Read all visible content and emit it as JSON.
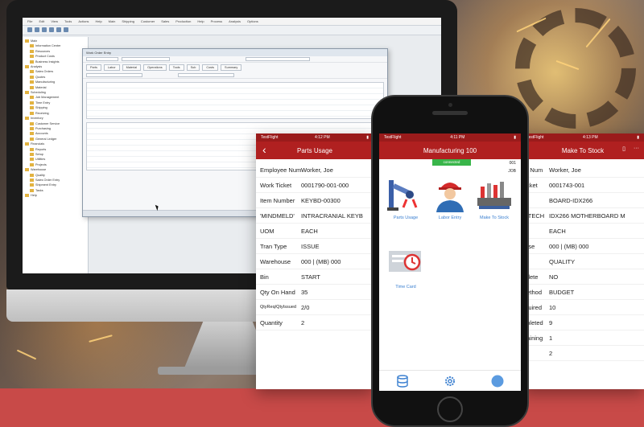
{
  "desktop": {
    "menu": [
      "File",
      "Edit",
      "View",
      "Tools",
      "Actions",
      "Help",
      "Main",
      "Shipping",
      "Customer",
      "Sales",
      "Production",
      "Help",
      "Process",
      "Analysis",
      "Options"
    ],
    "tree_items": [
      "Main",
      "Information Center",
      "Resources",
      "Product Costs",
      "Business Insights",
      "Analysis",
      "Sales Orders",
      "Quotes",
      "Manufacturing",
      "Material",
      "Scheduling",
      "Job Management",
      "Time Entry",
      "Shipping",
      "Receiving",
      "Inventory",
      "Customer Service",
      "Purchasing",
      "Accounts",
      "General Ledger",
      "Financials",
      "Reports",
      "Setup",
      "Utilities",
      "Projects",
      "Warehouse",
      "Quality",
      "Sales Order Entry",
      "Shipment Entry",
      "Tasks",
      "Help"
    ],
    "window_title": "Work Order Entry",
    "tabs": [
      "Parts",
      "Labor",
      "Material",
      "Operations",
      "Tools",
      "Sub",
      "Costs",
      "Summary"
    ]
  },
  "parts_usage": {
    "status_left": "TestFlight",
    "status_time": "4:12 PM",
    "title": "Parts Usage",
    "fields": [
      {
        "label": "Employee Num",
        "value": "Worker, Joe"
      },
      {
        "label": "Work Ticket",
        "value": "0001790-001-000"
      },
      {
        "label": "Item Number",
        "value": "KEYBD-00300"
      },
      {
        "label": "'MINDMELD'",
        "value": "INTRACRANIAL KEYB"
      },
      {
        "label": "UOM",
        "value": "EACH"
      },
      {
        "label": "Tran Type",
        "value": "ISSUE"
      },
      {
        "label": "Warehouse",
        "value": "000 | (MB) 000"
      },
      {
        "label": "Bin",
        "value": "START"
      },
      {
        "label": "Qty On Hand",
        "value": "35"
      },
      {
        "label": "QtyReq/QtyIssued",
        "value": "2/0"
      },
      {
        "label": "Quantity",
        "value": "2"
      }
    ]
  },
  "manufacturing": {
    "status_left": "TestFlight",
    "status_time": "4:11 PM",
    "title": "Manufacturing 100",
    "connection": "connected",
    "top_num": "001",
    "top_label": "JOB",
    "tiles": [
      {
        "label": "Parts Usage"
      },
      {
        "label": "Labor Entry"
      },
      {
        "label": "Make To Stock"
      },
      {
        "label": "Time Card"
      }
    ]
  },
  "make_to_stock": {
    "status_left": "TestFlight",
    "status_time": "4:13 PM",
    "title": "Make To Stock",
    "fields": [
      {
        "label": "ee Num",
        "value": "Worker, Joe"
      },
      {
        "label": "Ticket",
        "value": "0001743-001"
      },
      {
        "label": "",
        "value": "BOARD-IDX266"
      },
      {
        "label": "G TECH",
        "value": "IDX266 MOTHERBOARD M"
      },
      {
        "label": "",
        "value": "EACH"
      },
      {
        "label": "ouse",
        "value": "000 | (MB) 000"
      },
      {
        "label": "",
        "value": "QUALITY"
      },
      {
        "label": "nplete",
        "value": "NO"
      },
      {
        "label": "Method",
        "value": "BUDGET"
      },
      {
        "label": "equired",
        "value": "10"
      },
      {
        "label": "mpleted",
        "value": "9"
      },
      {
        "label": "maining",
        "value": "1"
      },
      {
        "label": "ity",
        "value": "2"
      }
    ]
  },
  "colors": {
    "header_red": "#b02020",
    "status_red": "#9a1b1b",
    "band_red": "#c84a48",
    "connected_green": "#39b54a",
    "link_blue": "#3a7fd0"
  },
  "icons": [
    "back-arrow-icon",
    "database-icon",
    "settings-gear-icon",
    "profile-circle-icon",
    "barcode-icon",
    "more-icon"
  ]
}
